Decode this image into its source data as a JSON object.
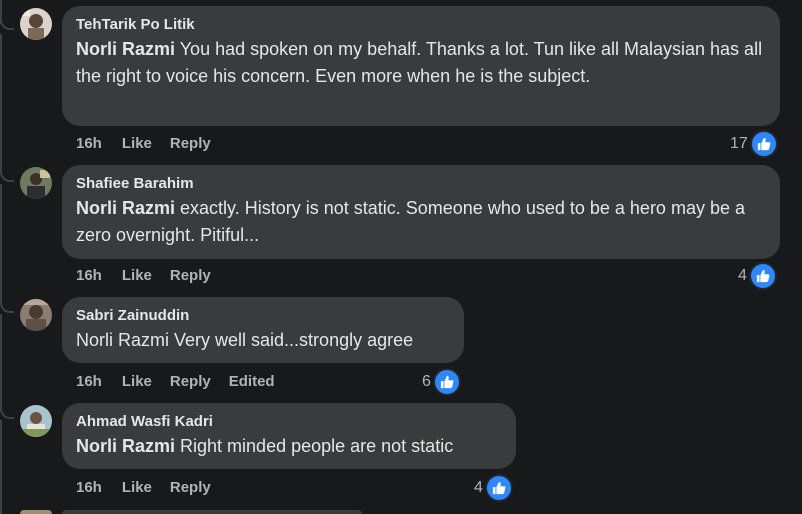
{
  "comments": [
    {
      "author": "TehTarik Po Litik",
      "mention": "Norli Razmi",
      "text": " You had spoken on my behalf. Thanks a lot. Tun like all Malaysian has all the right to voice his concern. Even more when he is the subject.",
      "time": "16h",
      "like_label": "Like",
      "reply_label": "Reply",
      "edited_label": "",
      "reaction_count": "17"
    },
    {
      "author": "Shafiee Barahim",
      "mention": "Norli Razmi",
      "text": " exactly. History is not static. Someone who used to be a hero may be a zero overnight. Pitiful...",
      "time": "16h",
      "like_label": "Like",
      "reply_label": "Reply",
      "edited_label": "",
      "reaction_count": "4"
    },
    {
      "author": "Sabri Zainuddin",
      "mention": "",
      "text": "Norli Razmi Very well said...strongly agree",
      "time": "16h",
      "like_label": "Like",
      "reply_label": "Reply",
      "edited_label": "Edited",
      "reaction_count": "6"
    },
    {
      "author": "Ahmad Wasfi Kadri",
      "mention": "Norli Razmi",
      "text": " Right minded people are not static",
      "time": "16h",
      "like_label": "Like",
      "reply_label": "Reply",
      "edited_label": "",
      "reaction_count": "4"
    }
  ],
  "colors": {
    "background": "#18191a",
    "bubble": "#3a3b3c",
    "like_blue": "#2d88ff",
    "meta_text": "#b0b3b8"
  }
}
